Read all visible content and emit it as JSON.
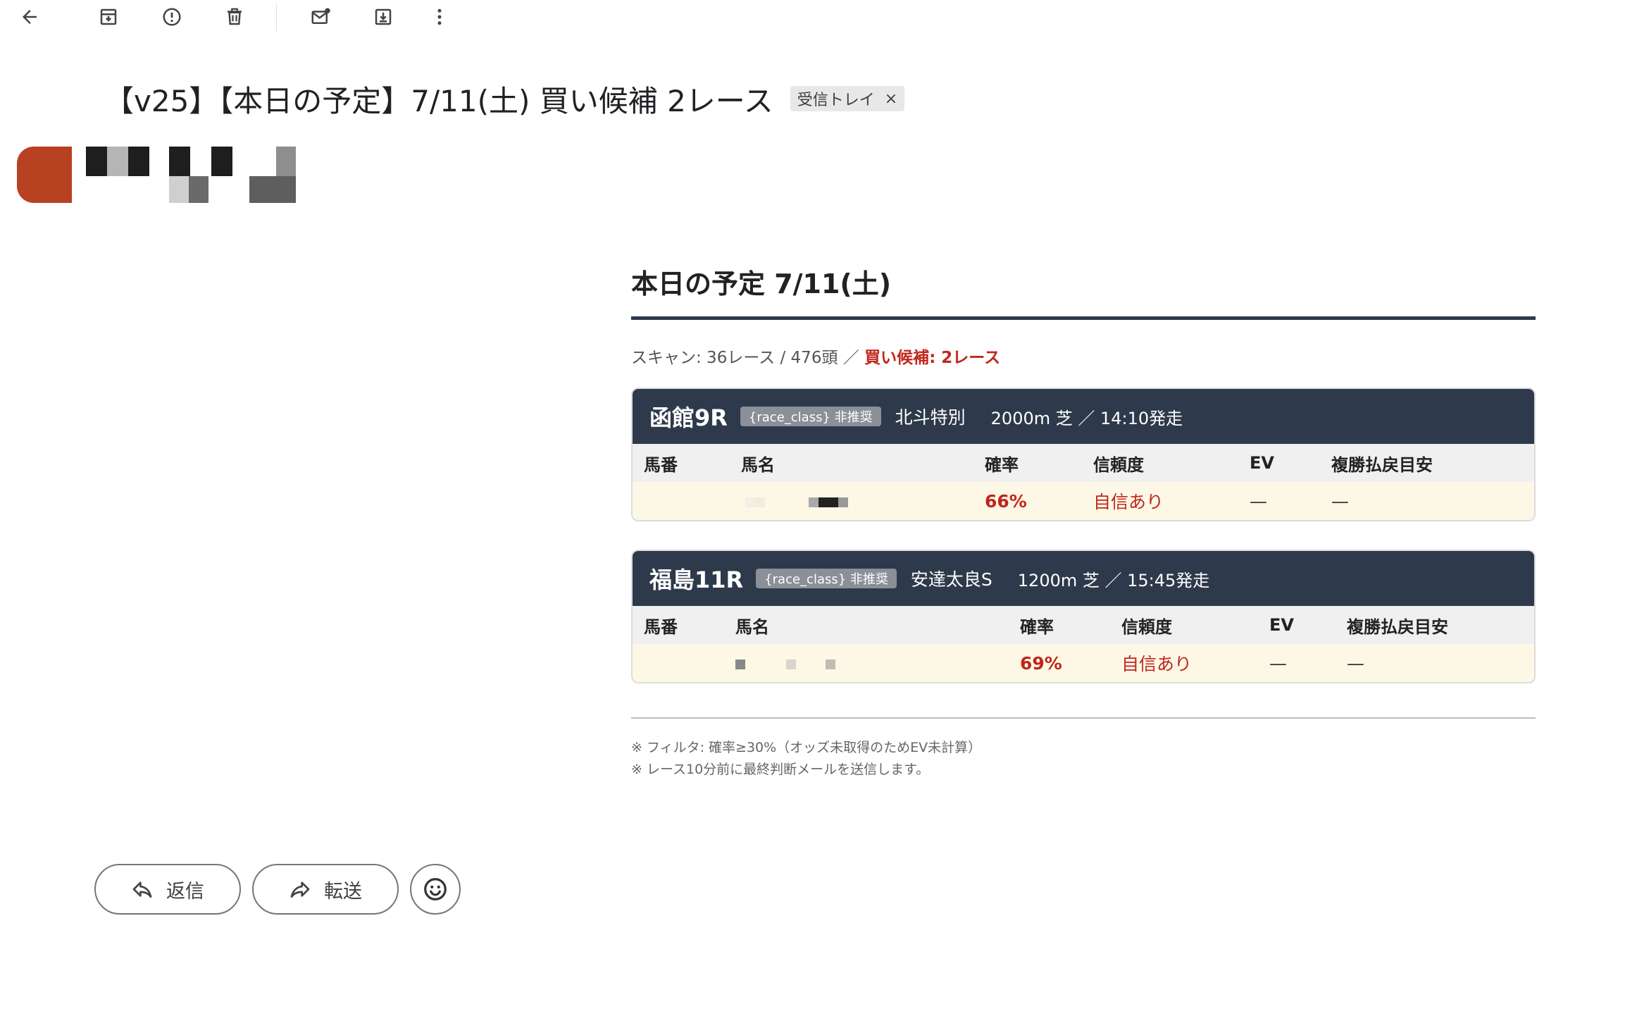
{
  "email": {
    "subject": "【v25】【本日の予定】7/11(土) 買い候補 2レース",
    "label_chip": "受信トレイ",
    "label_remove": "×"
  },
  "toolbar": {
    "icons": [
      "back-arrow-icon",
      "archive-icon",
      "report-spam-icon",
      "delete-icon",
      "mark-unread-icon",
      "move-to-icon",
      "more-vert-icon"
    ]
  },
  "content": {
    "title": "本日の予定 7/11(土)",
    "summary_scan": "スキャン: 36レース / 476頭 ／ ",
    "summary_candidates": "買い候補: 2レース",
    "columns": [
      "馬番",
      "馬名",
      "確率",
      "信頼度",
      "EV",
      "複勝払戻目安"
    ],
    "races": [
      {
        "name": "函館9R",
        "badge": "{race_class} 非推奨",
        "title": "北斗特別",
        "info": "2000m 芝 ／ 14:10発走",
        "row": {
          "number": "",
          "horse": "",
          "prob": "66%",
          "confidence": "自信あり",
          "ev": "—",
          "payout": "—"
        }
      },
      {
        "name": "福島11R",
        "badge": "{race_class} 非推奨",
        "title": "安達太良S",
        "info": "1200m 芝 ／ 15:45発走",
        "row": {
          "number": "",
          "horse": "",
          "prob": "69%",
          "confidence": "自信あり",
          "ev": "—",
          "payout": "—"
        }
      }
    ],
    "notes": [
      "※ フィルタ: 確率≥30%（オッズ未取得のためEV未計算）",
      "※ レース10分前に最終判断メールを送信します。"
    ]
  },
  "actions": {
    "reply": "返信",
    "forward": "転送"
  },
  "colors": {
    "header_bg": "#2e3a4b",
    "accent_red": "#c0261c",
    "row_bg": "#fdf8e6",
    "avatar": "#b84121"
  }
}
